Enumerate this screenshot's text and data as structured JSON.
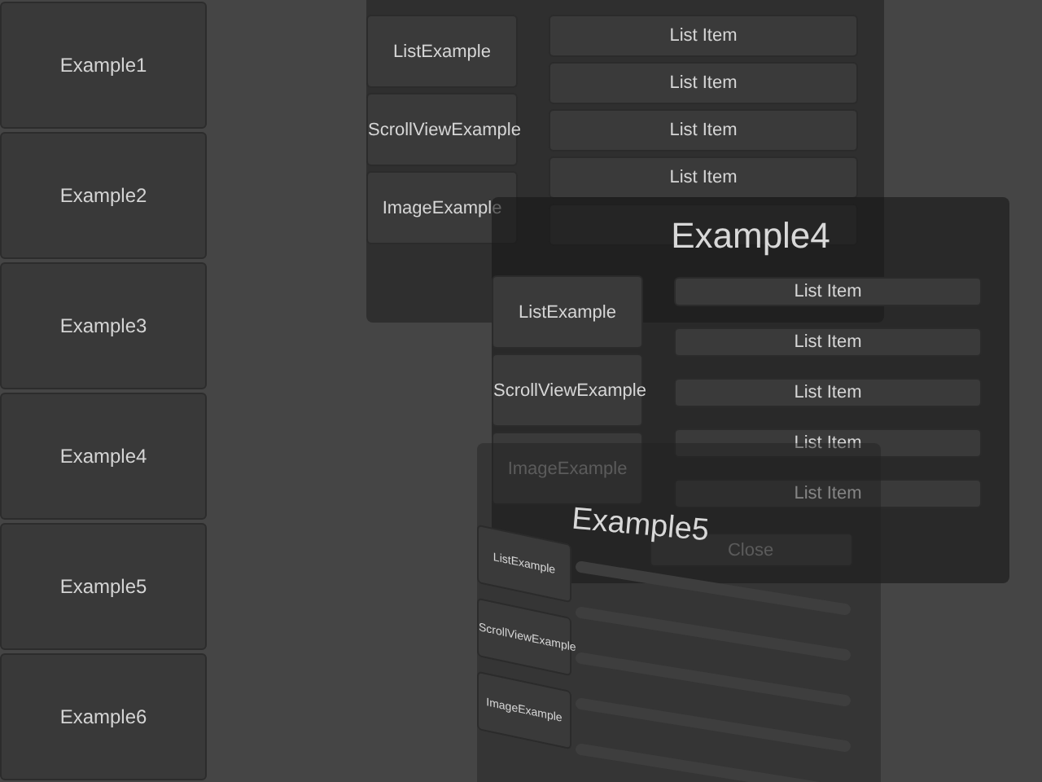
{
  "sidebar": {
    "items": [
      {
        "label": "Example1"
      },
      {
        "label": "Example2"
      },
      {
        "label": "Example3"
      },
      {
        "label": "Example4"
      },
      {
        "label": "Example5"
      },
      {
        "label": "Example6"
      }
    ]
  },
  "windows": [
    {
      "kind": "flat",
      "nav": [
        "ListExample",
        "ScrollViewExample",
        "ImageExample"
      ],
      "list": [
        "List Item",
        "List Item",
        "List Item",
        "List Item"
      ]
    },
    {
      "kind": "titled",
      "title": "Example4",
      "nav": [
        "ListExample",
        "ScrollViewExample",
        "ImageExample"
      ],
      "list": [
        "List Item",
        "List Item",
        "List Item",
        "List Item",
        "List Item"
      ],
      "close": "Close"
    },
    {
      "kind": "tilted",
      "title": "Example5",
      "nav": [
        "ListExample",
        "ScrollViewExample",
        "ImageExample"
      ]
    }
  ]
}
